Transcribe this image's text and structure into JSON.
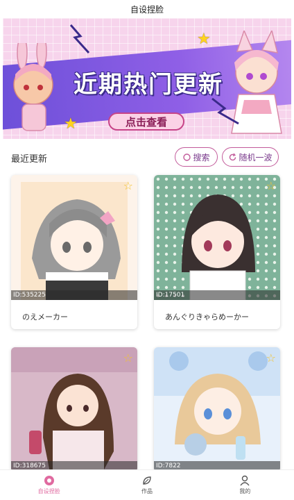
{
  "app": {
    "title": "自设捏脸"
  },
  "banner": {
    "headline": "近期热门更新",
    "cta": "点击查看"
  },
  "section": {
    "title": "最近更新",
    "search_label": "搜索",
    "random_label": "随机一波"
  },
  "cards": [
    {
      "id": "ID:535225",
      "name": "のえメーカー"
    },
    {
      "id": "ID:17501",
      "name": "あんぐりきゃらめーかー"
    },
    {
      "id": "ID:318675",
      "name": ""
    },
    {
      "id": "ID:7822",
      "name": ""
    }
  ],
  "tabs": [
    {
      "label": "自设捏脸",
      "icon": "face-icon",
      "active": true
    },
    {
      "label": "作品",
      "icon": "leaf-icon",
      "active": false
    },
    {
      "label": "我的",
      "icon": "person-icon",
      "active": false
    }
  ],
  "colors": {
    "accent": "#e06aa0",
    "banner_purple": "#6b4fd8",
    "pill_border": "#c25a9a"
  }
}
